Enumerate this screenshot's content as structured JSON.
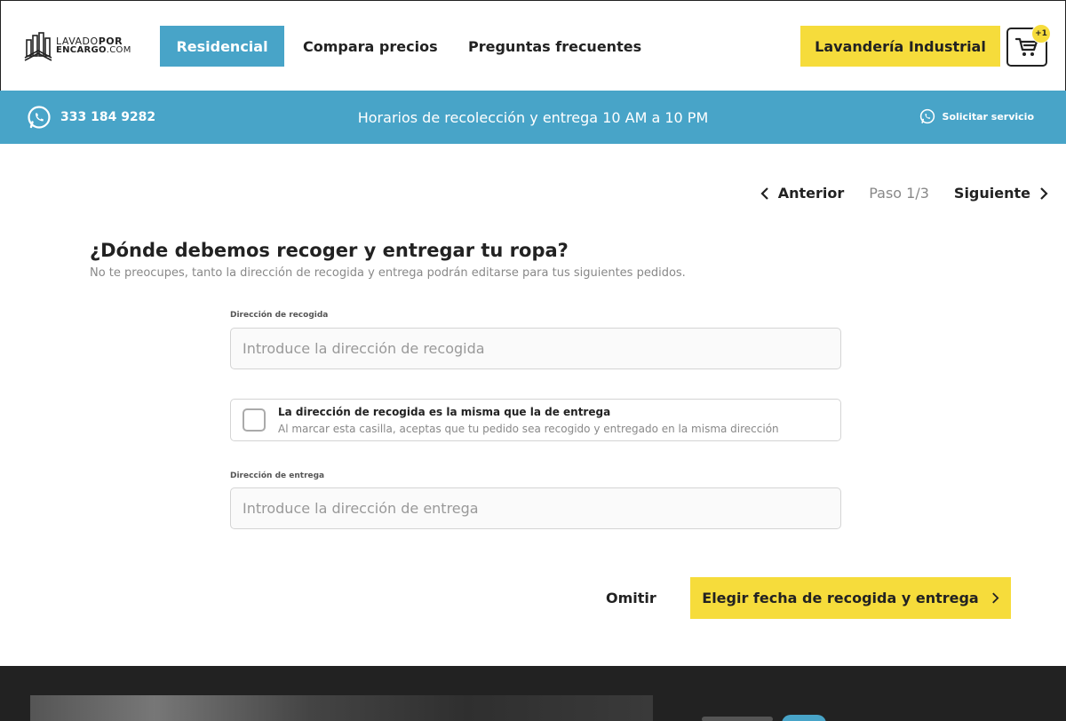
{
  "brand": {
    "line1_a": "LAVADO",
    "line1_b": "POR",
    "line2_a": "ENCARGO",
    "line2_b": ".COM"
  },
  "nav": {
    "residencial": "Residencial",
    "compara": "Compara precios",
    "faq": "Preguntas frecuentes"
  },
  "header": {
    "industrial_button": "Lavandería Industrial",
    "cart_badge": "+1"
  },
  "infobar": {
    "phone": "333 184 9282",
    "hours": "Horarios de recolección y entrega 10 AM a 10 PM",
    "solicitar": "Solicitar servicio"
  },
  "steps": {
    "prev": "Anterior",
    "current": "Paso 1/3",
    "next": "Siguiente"
  },
  "form": {
    "title": "¿Dónde debemos recoger y entregar tu ropa?",
    "subtitle": "No te preocupes, tanto la dirección de recogida y entrega podrán editarse para tus siguientes pedidos.",
    "pickup_label": "Dirección de recogida",
    "pickup_placeholder": "Introduce la dirección de recogida",
    "pickup_value": "",
    "same_title": "La dirección de recogida es la misma que la de entrega",
    "same_desc": "Al marcar esta casilla, aceptas que tu pedido sea recogido y entregado en la misma dirección",
    "same_checked": false,
    "delivery_label": "Dirección de entrega",
    "delivery_placeholder": "Introduce la dirección de entrega",
    "delivery_value": "",
    "skip": "Omitir",
    "submit": "Elegir fecha de recogida y entrega"
  },
  "icons": {
    "logo": "logo-mark-icon",
    "cart": "cart-icon",
    "whatsapp": "whatsapp-icon",
    "prev": "chevron-left-icon",
    "next": "chevron-right-icon"
  },
  "colors": {
    "accent_blue": "#48a4c8",
    "accent_yellow": "#f6dc3b",
    "dark": "#222222",
    "muted": "#888888"
  }
}
